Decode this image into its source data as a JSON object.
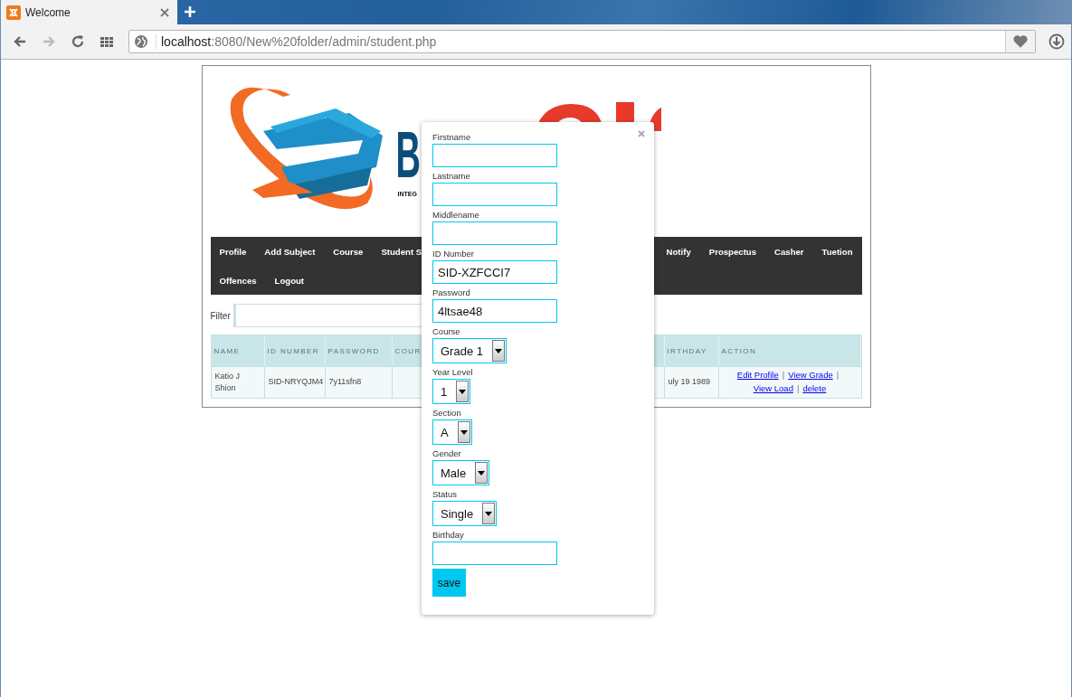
{
  "browser": {
    "tab": {
      "title": "Welcome",
      "selected": true
    },
    "url": {
      "host": "localhost",
      "path": ":8080/New%20folder/admin/student.php"
    }
  },
  "logo": {
    "mark": "B",
    "tagline": "INTEG"
  },
  "nav": {
    "rows": [
      {
        "left": [
          "Profile",
          "Add Subject",
          "Course",
          "Student S"
        ],
        "right": [
          "Notify",
          "Prospectus",
          "Casher",
          "Tuetion"
        ]
      },
      {
        "left": [
          "Offences",
          "Logout"
        ],
        "right": []
      }
    ]
  },
  "filter": {
    "label": "Filter"
  },
  "table": {
    "columns": [
      "NAME",
      "ID NUMBER",
      "PASSWORD",
      "COUR",
      "IRTHDAY",
      "ACTION"
    ],
    "rows": [
      {
        "cells": [
          "Katio J Shion",
          "SID-NRYQJM4",
          "7y11sfn8",
          "",
          "uly 19 1989"
        ],
        "actions": [
          "Edit Profile",
          "View Grade",
          "View Load",
          "delete"
        ],
        "separator": "|"
      }
    ]
  },
  "modal": {
    "fields": [
      {
        "kind": "text",
        "label": "Firstname"
      },
      {
        "kind": "text",
        "label": "Lastname"
      },
      {
        "kind": "text",
        "label": "Middlename"
      },
      {
        "kind": "text",
        "label": "ID Number",
        "value": "SID-XZFCCI7"
      },
      {
        "kind": "text",
        "label": "Password",
        "value": "4ltsae48"
      },
      {
        "kind": "select",
        "label": "Course",
        "value": "Grade 1"
      },
      {
        "kind": "select",
        "label": "Year Level",
        "value": "1"
      },
      {
        "kind": "select",
        "label": "Section",
        "value": "A"
      },
      {
        "kind": "select",
        "label": "Gender",
        "value": "Male"
      },
      {
        "kind": "select",
        "label": "Status",
        "value": "Single"
      },
      {
        "kind": "text",
        "label": "Birthday"
      }
    ],
    "button": "save"
  }
}
